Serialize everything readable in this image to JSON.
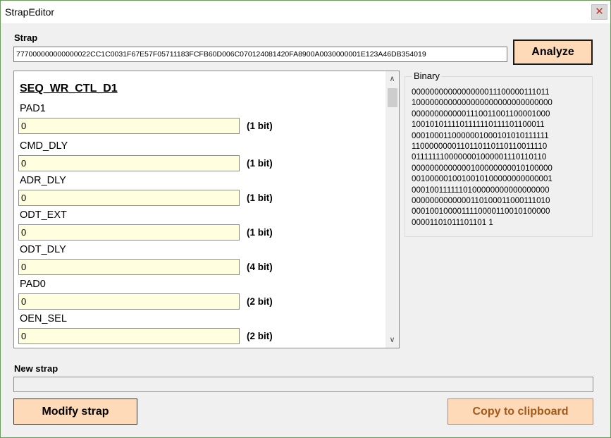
{
  "window": {
    "title": "StrapEditor",
    "close_glyph": "✕"
  },
  "strap": {
    "label": "Strap",
    "value": "777000000000000022CC1C0031F67E57F05711183FCFB60D006C070124081420FA8900A0030000001E123A46DB354019"
  },
  "analyze_label": "Analyze",
  "fields_panel": {
    "section_title": "SEQ_WR_CTL_D1",
    "fields": [
      {
        "name": "PAD1",
        "value": "0",
        "bits": "(1 bit)"
      },
      {
        "name": "CMD_DLY",
        "value": "0",
        "bits": "(1 bit)"
      },
      {
        "name": "ADR_DLY",
        "value": "0",
        "bits": "(1 bit)"
      },
      {
        "name": "ODT_EXT",
        "value": "0",
        "bits": "(1 bit)"
      },
      {
        "name": "ODT_DLY",
        "value": "0",
        "bits": "(4 bit)"
      },
      {
        "name": "PAD0",
        "value": "0",
        "bits": "(2 bit)"
      },
      {
        "name": "OEN_SEL",
        "value": "0",
        "bits": "(2 bit)"
      }
    ]
  },
  "binary": {
    "legend": "Binary",
    "lines": [
      "0000000000000000011100000111011",
      "1000000000000000000000000000000",
      "0000000000001110011001100001000",
      "1001010111101111110111101100011",
      "0001000110000001000101010111111",
      "1100000000110110110110110011110",
      "0111111100000001000001110110110",
      "0000000000000100000000010100000",
      "0010000010010010100000000000001",
      "0001001111110100000000000000000",
      "0000000000000110100011000111010",
      "0001001000011110000110010100000",
      "00001101011101101 1"
    ],
    "text": "0000000000000000011100000111011100000000000000000000000000000000000000000000111001100110000100010010101111011111101111011000110001000110000001000101010111111110000000011011011011011001111001111111000000010000011101101100000000000001000000000101000000010000000100100101000000000000010001001111110100000000000000000000000000000000110100011000111010000100100001111000011001010000000000110101110110111"
  },
  "new_strap": {
    "label": "New strap",
    "value": ""
  },
  "buttons": {
    "modify": "Modify strap",
    "copy": "Copy to clipboard"
  },
  "scroll": {
    "up_glyph": "∧",
    "down_glyph": "∨"
  },
  "colors": {
    "button_fill": "#ffdab8",
    "input_fill": "#ffffe0",
    "copy_text": "#a25a1a",
    "window_border": "#6b9b5a"
  }
}
